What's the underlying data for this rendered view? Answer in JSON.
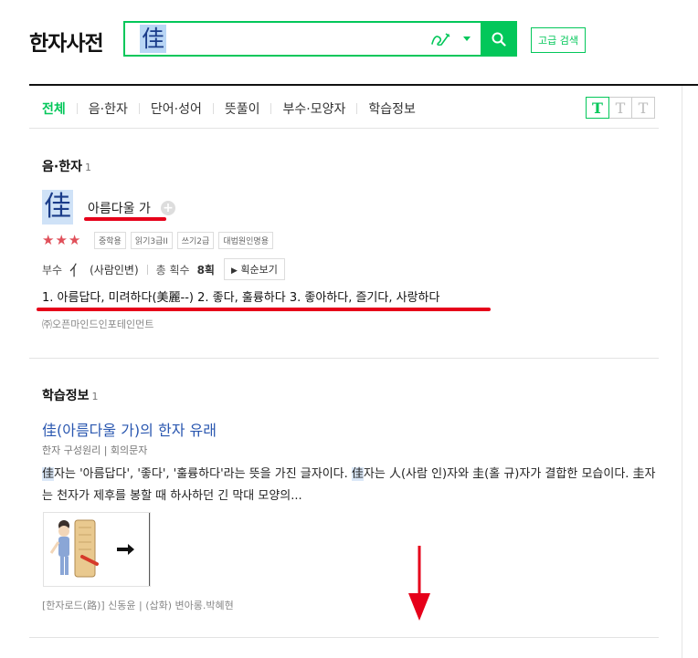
{
  "logo": "한자사전",
  "search": {
    "query": "佳"
  },
  "advanced_search_label": "고급 검색",
  "tabs": [
    {
      "label": "전체",
      "active": true
    },
    {
      "label": "음·한자",
      "active": false
    },
    {
      "label": "단어·성어",
      "active": false
    },
    {
      "label": "뜻풀이",
      "active": false
    },
    {
      "label": "부수·모양자",
      "active": false
    },
    {
      "label": "학습정보",
      "active": false
    }
  ],
  "font_toggle": [
    "T",
    "T",
    "T"
  ],
  "eum_hanja": {
    "title": "음·한자",
    "count": "1",
    "character": "佳",
    "reading": "아름다울 가",
    "stars": "★★★",
    "badges": [
      "중학용",
      "읽기3급II",
      "쓰기2급",
      "대법원인명용"
    ],
    "radical_label": "부수",
    "radical": "亻",
    "radical_name": "(사람인변)",
    "strokes_label": "총 획수",
    "strokes": "8획",
    "stroke_order_btn": "획순보기",
    "meanings": "1. 아름답다, 미려하다(美麗--)  2. 좋다, 훌륭하다  3. 좋아하다, 즐기다, 사랑하다",
    "source": "㈜오픈마인드인포테인먼트"
  },
  "study": {
    "title": "학습정보",
    "count": "1",
    "article_title": "佳(아름다울 가)의 한자 유래",
    "article_sub": "한자 구성원리 | 회의문자",
    "body_char1": "佳",
    "body_part1": "자는 '아름답다', '좋다', '훌륭하다'라는 뜻을 가진 글자이다. ",
    "body_char2": "佳",
    "body_part2": "자는 人(사람 인)자와 圭(홀 규)자가 결합한 모습이다. 圭자는 천자가 제후를 봉할 때 하사하던 긴 막대 모양의...",
    "image_caption": "[한자로드(路)] 신동윤 | (삽화) 변아롱.박혜현"
  },
  "colors": {
    "accent": "#03c75a",
    "link": "#2a57b0",
    "annotation_red": "#e6001a"
  },
  "icons": [
    "handwriting-icon",
    "dropdown-icon",
    "search-icon",
    "plus-icon",
    "play-icon",
    "down-arrow-icon"
  ]
}
